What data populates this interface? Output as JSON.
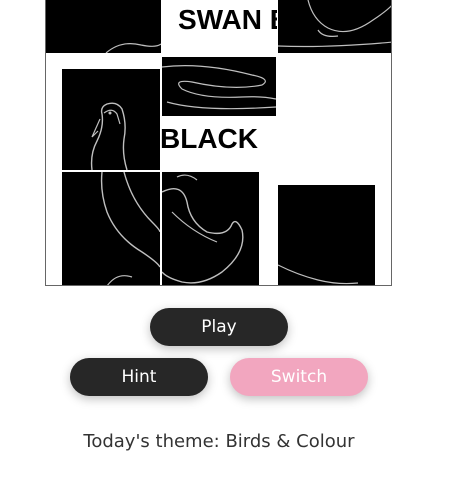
{
  "puzzle": {
    "tiles": [
      {
        "id": "tile-top-left",
        "kind": "swan-lines"
      },
      {
        "id": "tile-top-middle",
        "kind": "text",
        "text": "SWAN B"
      },
      {
        "id": "tile-top-right",
        "kind": "swan-lines"
      },
      {
        "id": "tile-middle-left",
        "kind": "swan-head"
      },
      {
        "id": "tile-middle-middle-upper",
        "kind": "swan-lines"
      },
      {
        "id": "tile-middle-middle-text",
        "kind": "text",
        "text": "BLACK"
      },
      {
        "id": "tile-bottom-left",
        "kind": "swan-neck"
      },
      {
        "id": "tile-bottom-middle",
        "kind": "swan-wing"
      },
      {
        "id": "tile-bottom-right",
        "kind": "blank-black"
      }
    ]
  },
  "controls": {
    "play_label": "Play",
    "hint_label": "Hint",
    "switch_label": "Switch"
  },
  "theme": {
    "label": "Today's theme: Birds & Colour"
  },
  "colors": {
    "tile_background": "#000000",
    "line_color": "#bfbfbf",
    "button_dark": "#272727",
    "button_pink": "#f2a6bf"
  }
}
